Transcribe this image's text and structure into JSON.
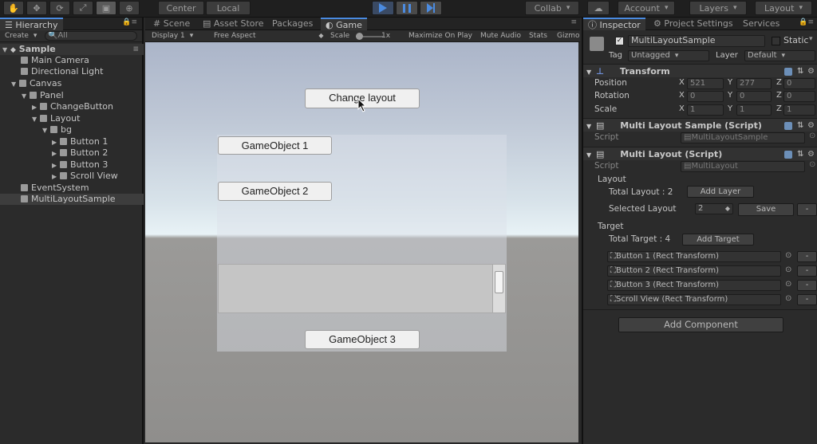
{
  "toolbar": {
    "center_label": "Center",
    "local_label": "Local",
    "collab_label": "Collab",
    "account_label": "Account",
    "layers_label": "Layers",
    "layout_label": "Layout"
  },
  "hierarchy": {
    "tab_label": "Hierarchy",
    "create_label": "Create",
    "search_placeholder": "All",
    "scene_name": "Sample",
    "items": [
      {
        "label": "Main Camera"
      },
      {
        "label": "Directional Light"
      },
      {
        "label": "Canvas"
      },
      {
        "label": "Panel"
      },
      {
        "label": "ChangeButton"
      },
      {
        "label": "Layout"
      },
      {
        "label": "bg"
      },
      {
        "label": "Button 1"
      },
      {
        "label": "Button 2"
      },
      {
        "label": "Button 3"
      },
      {
        "label": "Scroll View"
      },
      {
        "label": "EventSystem"
      },
      {
        "label": "MultiLayoutSample"
      }
    ]
  },
  "center_tabs": [
    "Scene",
    "Asset Store",
    "Packages",
    "Game"
  ],
  "game_bar": {
    "display": "Display 1",
    "aspect": "Free Aspect",
    "scale_label": "Scale",
    "scale_value": "1x",
    "maximize": "Maximize On Play",
    "mute": "Mute Audio",
    "stats": "Stats",
    "gizmos": "Gizmo"
  },
  "game": {
    "change_layout": "Change layout",
    "go1": "GameObject 1",
    "go2": "GameObject 2",
    "go3": "GameObject 3"
  },
  "inspector": {
    "tabs": [
      "Inspector",
      "Project Settings",
      "Services"
    ],
    "object_name": "MultiLayoutSample",
    "static_label": "Static",
    "tag_label": "Tag",
    "tag_value": "Untagged",
    "layer_label": "Layer",
    "layer_value": "Default",
    "transform": {
      "title": "Transform",
      "position_label": "Position",
      "rotation_label": "Rotation",
      "scale_label": "Scale",
      "position": {
        "x": "521",
        "y": "277",
        "z": "0"
      },
      "rotation": {
        "x": "0",
        "y": "0",
        "z": "0"
      },
      "scale": {
        "x": "1",
        "y": "1",
        "z": "1"
      }
    },
    "sample_script": {
      "title": "Multi Layout Sample (Script)",
      "script_label": "Script",
      "script_value": "MultiLayoutSample"
    },
    "multi_layout": {
      "title": "Multi Layout (Script)",
      "script_label": "Script",
      "script_value": "MultiLayout",
      "layout_header": "Layout",
      "total_layout": "Total Layout : 2",
      "add_layer": "Add Layer",
      "selected_layout_label": "Selected Layout",
      "selected_layout_value": "2",
      "save": "Save",
      "minus": "-",
      "target_header": "Target",
      "total_target": "Total Target : 4",
      "add_target": "Add Target",
      "targets": [
        "Button 1 (Rect Transform)",
        "Button 2 (Rect Transform)",
        "Button 3 (Rect Transform)",
        "Scroll View (Rect Transform)"
      ]
    },
    "add_component": "Add Component"
  }
}
